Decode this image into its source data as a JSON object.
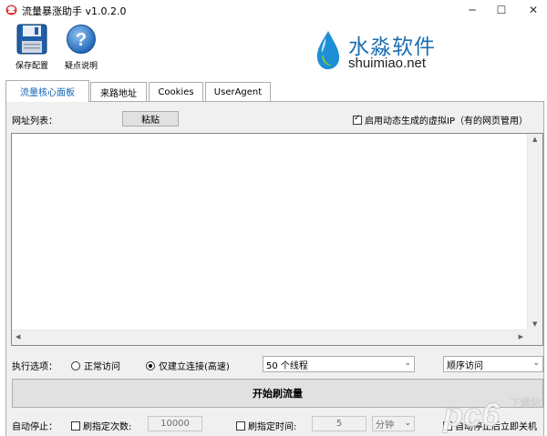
{
  "window": {
    "title": "流量暴涨助手 v1.0.2.0",
    "minimize": "─",
    "maximize": "☐",
    "close": "✕"
  },
  "toolbar": {
    "save_label": "保存配置",
    "help_label": "疑点说明"
  },
  "logo": {
    "cn": "水淼软件",
    "en": "shuimiao.net"
  },
  "tabs": [
    {
      "label": "流量核心面板",
      "active": true
    },
    {
      "label": "来路地址",
      "active": false
    },
    {
      "label": "Cookies",
      "active": false
    },
    {
      "label": "UserAgent",
      "active": false
    }
  ],
  "main": {
    "url_list_label": "网址列表：",
    "paste_label": "粘贴",
    "virtual_ip_label": "启用动态生成的虚拟IP（有的网页管用）",
    "virtual_ip_checked": true,
    "url_list_value": ""
  },
  "options": {
    "label": "执行选项：",
    "normal_label": "正常访问",
    "fast_label": "仅建立连接(高速)",
    "selected": "fast",
    "threads_value": "50 个线程",
    "order_value": "顺序访问"
  },
  "start_label": "开始刷流量",
  "auto_stop": {
    "label": "自动停止：",
    "count_label": "刷指定次数:",
    "count_value": "10000",
    "time_label": "刷指定时间:",
    "time_value": "5",
    "unit_value": "分钟",
    "shutdown_label": "自动停止后立即关机"
  },
  "watermark": {
    "text": "pc6",
    "sub": "下载站"
  }
}
